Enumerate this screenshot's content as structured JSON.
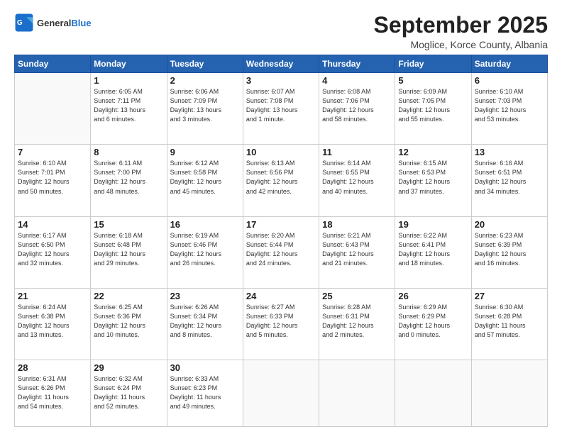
{
  "logo": {
    "line1": "General",
    "line2": "Blue"
  },
  "title": "September 2025",
  "subtitle": "Moglice, Korce County, Albania",
  "days_header": [
    "Sunday",
    "Monday",
    "Tuesday",
    "Wednesday",
    "Thursday",
    "Friday",
    "Saturday"
  ],
  "weeks": [
    [
      {
        "day": "",
        "info": ""
      },
      {
        "day": "1",
        "info": "Sunrise: 6:05 AM\nSunset: 7:11 PM\nDaylight: 13 hours\nand 6 minutes."
      },
      {
        "day": "2",
        "info": "Sunrise: 6:06 AM\nSunset: 7:09 PM\nDaylight: 13 hours\nand 3 minutes."
      },
      {
        "day": "3",
        "info": "Sunrise: 6:07 AM\nSunset: 7:08 PM\nDaylight: 13 hours\nand 1 minute."
      },
      {
        "day": "4",
        "info": "Sunrise: 6:08 AM\nSunset: 7:06 PM\nDaylight: 12 hours\nand 58 minutes."
      },
      {
        "day": "5",
        "info": "Sunrise: 6:09 AM\nSunset: 7:05 PM\nDaylight: 12 hours\nand 55 minutes."
      },
      {
        "day": "6",
        "info": "Sunrise: 6:10 AM\nSunset: 7:03 PM\nDaylight: 12 hours\nand 53 minutes."
      }
    ],
    [
      {
        "day": "7",
        "info": "Sunrise: 6:10 AM\nSunset: 7:01 PM\nDaylight: 12 hours\nand 50 minutes."
      },
      {
        "day": "8",
        "info": "Sunrise: 6:11 AM\nSunset: 7:00 PM\nDaylight: 12 hours\nand 48 minutes."
      },
      {
        "day": "9",
        "info": "Sunrise: 6:12 AM\nSunset: 6:58 PM\nDaylight: 12 hours\nand 45 minutes."
      },
      {
        "day": "10",
        "info": "Sunrise: 6:13 AM\nSunset: 6:56 PM\nDaylight: 12 hours\nand 42 minutes."
      },
      {
        "day": "11",
        "info": "Sunrise: 6:14 AM\nSunset: 6:55 PM\nDaylight: 12 hours\nand 40 minutes."
      },
      {
        "day": "12",
        "info": "Sunrise: 6:15 AM\nSunset: 6:53 PM\nDaylight: 12 hours\nand 37 minutes."
      },
      {
        "day": "13",
        "info": "Sunrise: 6:16 AM\nSunset: 6:51 PM\nDaylight: 12 hours\nand 34 minutes."
      }
    ],
    [
      {
        "day": "14",
        "info": "Sunrise: 6:17 AM\nSunset: 6:50 PM\nDaylight: 12 hours\nand 32 minutes."
      },
      {
        "day": "15",
        "info": "Sunrise: 6:18 AM\nSunset: 6:48 PM\nDaylight: 12 hours\nand 29 minutes."
      },
      {
        "day": "16",
        "info": "Sunrise: 6:19 AM\nSunset: 6:46 PM\nDaylight: 12 hours\nand 26 minutes."
      },
      {
        "day": "17",
        "info": "Sunrise: 6:20 AM\nSunset: 6:44 PM\nDaylight: 12 hours\nand 24 minutes."
      },
      {
        "day": "18",
        "info": "Sunrise: 6:21 AM\nSunset: 6:43 PM\nDaylight: 12 hours\nand 21 minutes."
      },
      {
        "day": "19",
        "info": "Sunrise: 6:22 AM\nSunset: 6:41 PM\nDaylight: 12 hours\nand 18 minutes."
      },
      {
        "day": "20",
        "info": "Sunrise: 6:23 AM\nSunset: 6:39 PM\nDaylight: 12 hours\nand 16 minutes."
      }
    ],
    [
      {
        "day": "21",
        "info": "Sunrise: 6:24 AM\nSunset: 6:38 PM\nDaylight: 12 hours\nand 13 minutes."
      },
      {
        "day": "22",
        "info": "Sunrise: 6:25 AM\nSunset: 6:36 PM\nDaylight: 12 hours\nand 10 minutes."
      },
      {
        "day": "23",
        "info": "Sunrise: 6:26 AM\nSunset: 6:34 PM\nDaylight: 12 hours\nand 8 minutes."
      },
      {
        "day": "24",
        "info": "Sunrise: 6:27 AM\nSunset: 6:33 PM\nDaylight: 12 hours\nand 5 minutes."
      },
      {
        "day": "25",
        "info": "Sunrise: 6:28 AM\nSunset: 6:31 PM\nDaylight: 12 hours\nand 2 minutes."
      },
      {
        "day": "26",
        "info": "Sunrise: 6:29 AM\nSunset: 6:29 PM\nDaylight: 12 hours\nand 0 minutes."
      },
      {
        "day": "27",
        "info": "Sunrise: 6:30 AM\nSunset: 6:28 PM\nDaylight: 11 hours\nand 57 minutes."
      }
    ],
    [
      {
        "day": "28",
        "info": "Sunrise: 6:31 AM\nSunset: 6:26 PM\nDaylight: 11 hours\nand 54 minutes."
      },
      {
        "day": "29",
        "info": "Sunrise: 6:32 AM\nSunset: 6:24 PM\nDaylight: 11 hours\nand 52 minutes."
      },
      {
        "day": "30",
        "info": "Sunrise: 6:33 AM\nSunset: 6:23 PM\nDaylight: 11 hours\nand 49 minutes."
      },
      {
        "day": "",
        "info": ""
      },
      {
        "day": "",
        "info": ""
      },
      {
        "day": "",
        "info": ""
      },
      {
        "day": "",
        "info": ""
      }
    ]
  ]
}
